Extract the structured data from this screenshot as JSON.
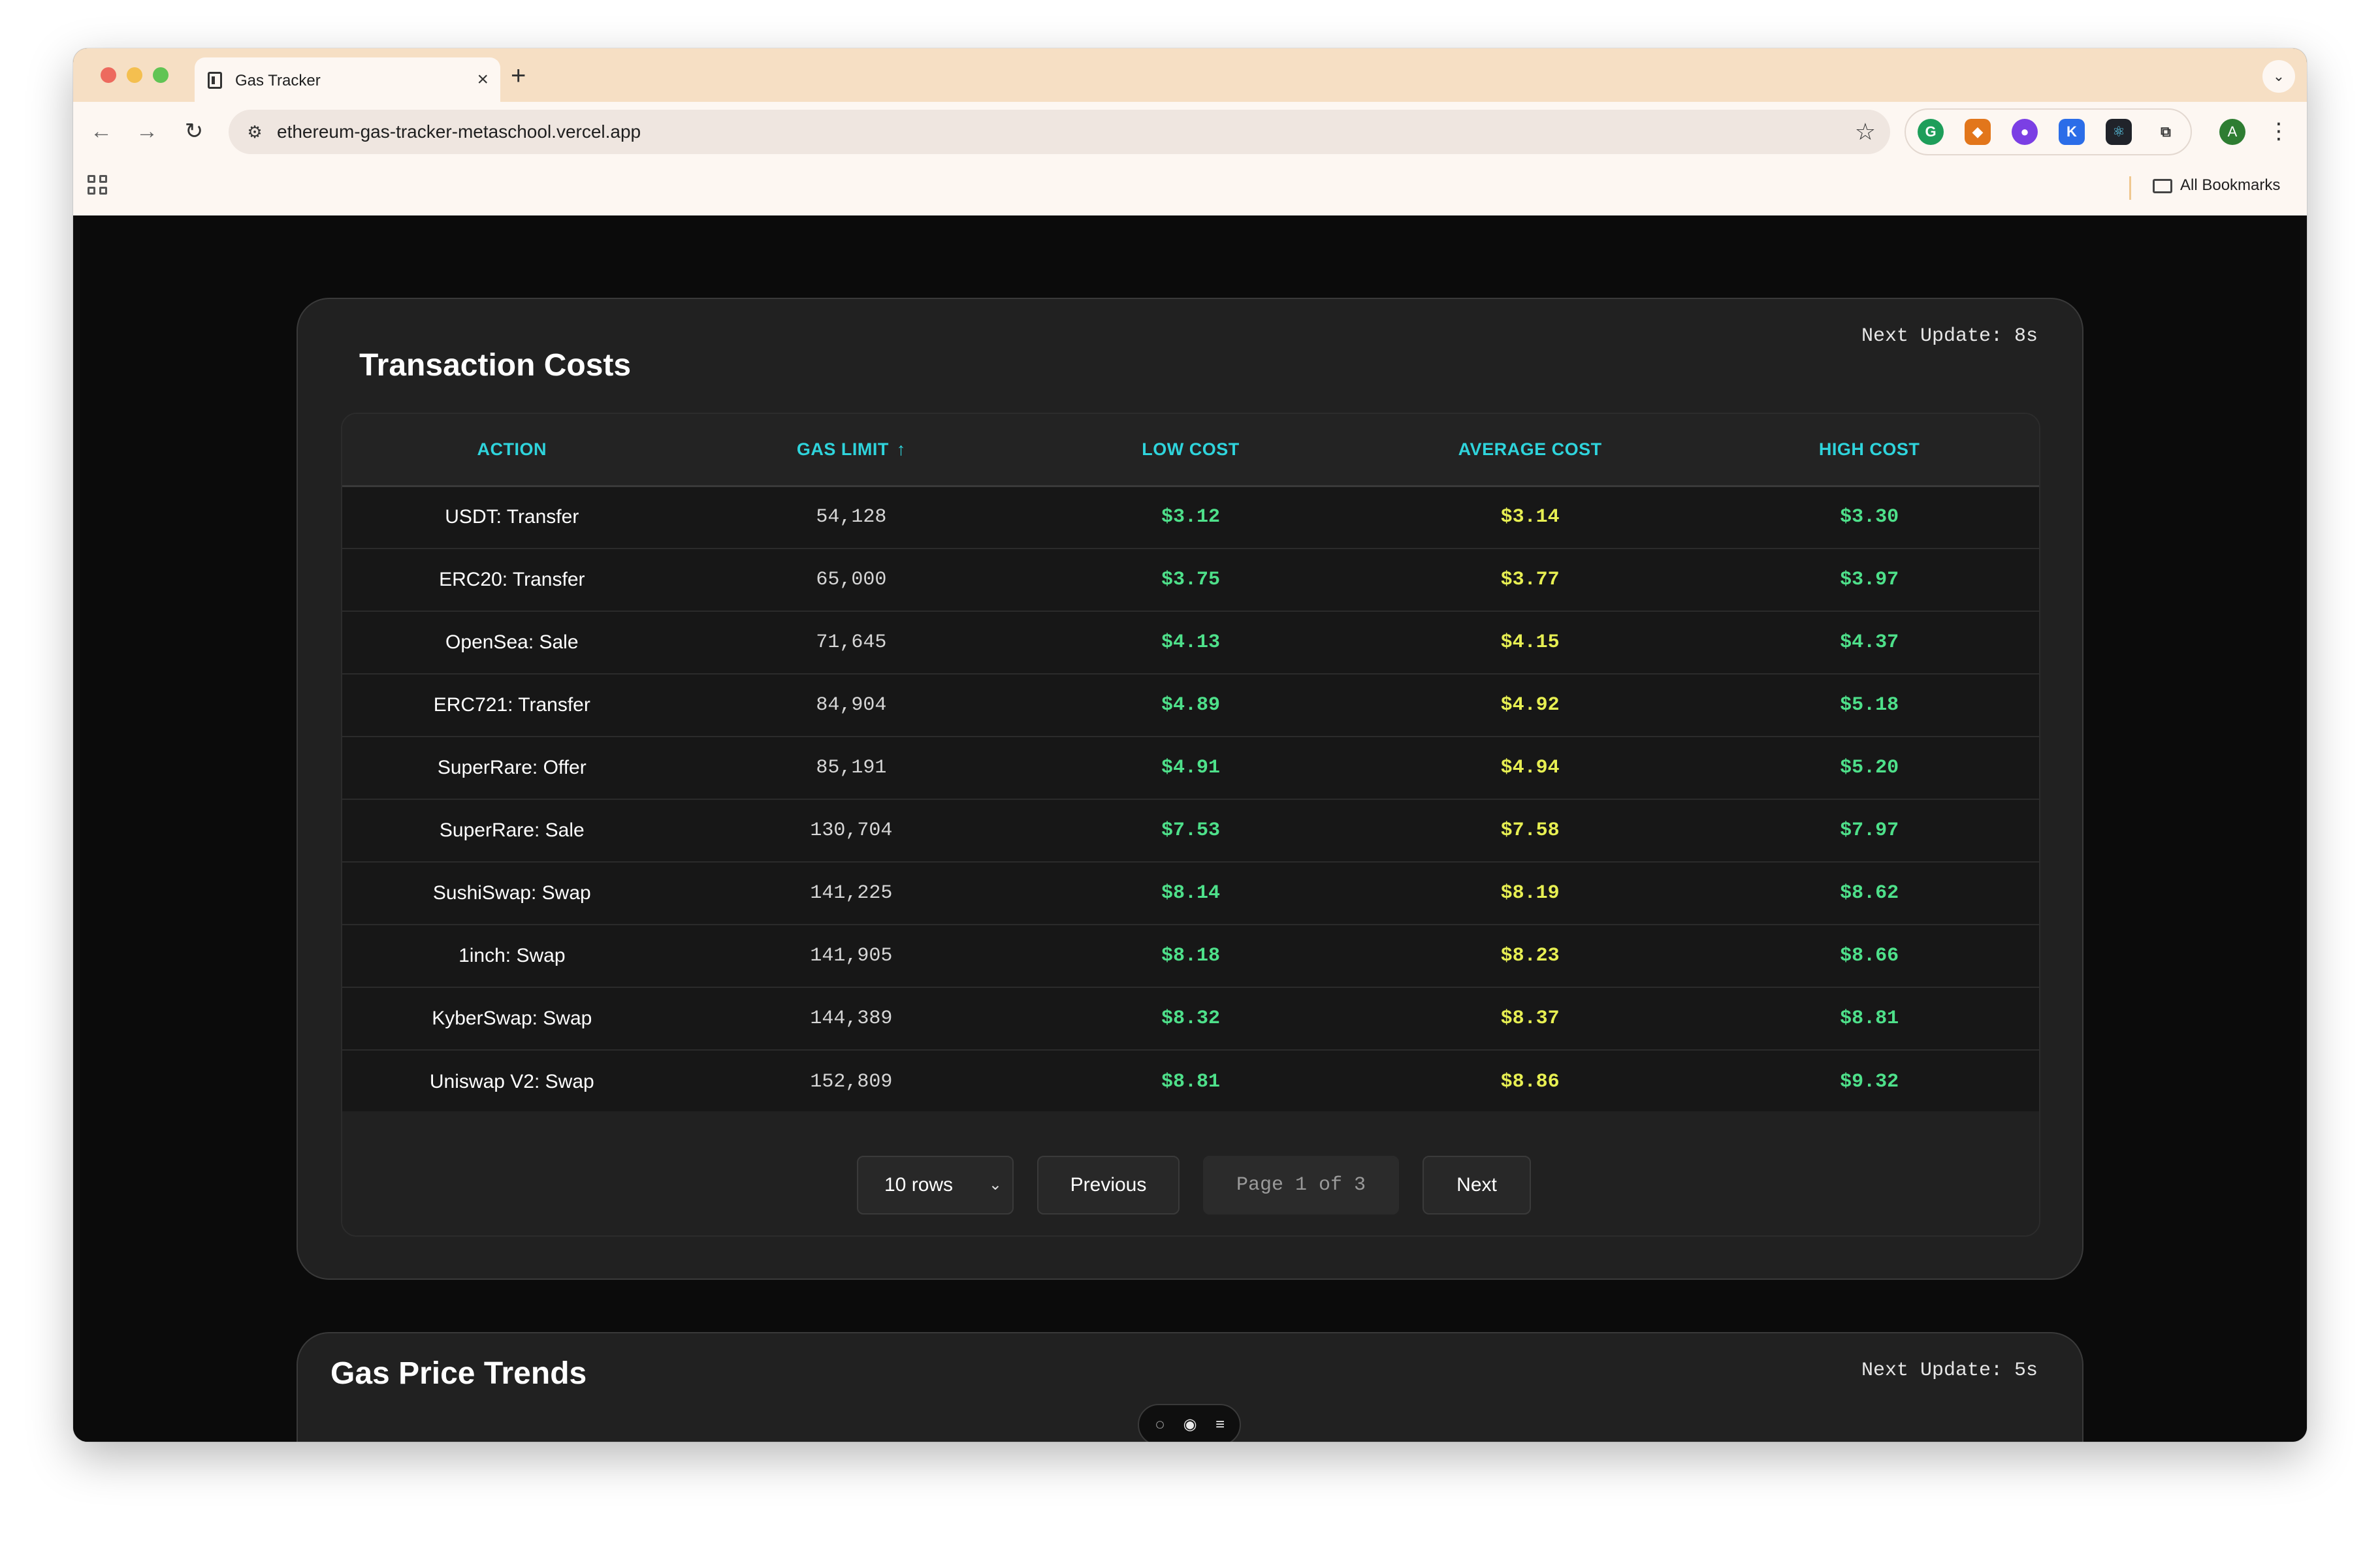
{
  "browser": {
    "tab_title": "Gas Tracker",
    "url": "ethereum-gas-tracker-metaschool.vercel.app",
    "profile_initial": "A",
    "all_bookmarks": "All Bookmarks"
  },
  "transaction_costs": {
    "title": "Transaction Costs",
    "next_update": "Next Update: 8s",
    "columns": [
      "ACTION",
      "GAS LIMIT",
      "LOW COST",
      "AVERAGE COST",
      "HIGH COST"
    ],
    "sort_indicator": "↑",
    "rows": [
      {
        "action": "USDT: Transfer",
        "gas_limit": "54,128",
        "low": "$3.12",
        "avg": "$3.14",
        "high": "$3.30"
      },
      {
        "action": "ERC20: Transfer",
        "gas_limit": "65,000",
        "low": "$3.75",
        "avg": "$3.77",
        "high": "$3.97"
      },
      {
        "action": "OpenSea: Sale",
        "gas_limit": "71,645",
        "low": "$4.13",
        "avg": "$4.15",
        "high": "$4.37"
      },
      {
        "action": "ERC721: Transfer",
        "gas_limit": "84,904",
        "low": "$4.89",
        "avg": "$4.92",
        "high": "$5.18"
      },
      {
        "action": "SuperRare: Offer",
        "gas_limit": "85,191",
        "low": "$4.91",
        "avg": "$4.94",
        "high": "$5.20"
      },
      {
        "action": "SuperRare: Sale",
        "gas_limit": "130,704",
        "low": "$7.53",
        "avg": "$7.58",
        "high": "$7.97"
      },
      {
        "action": "SushiSwap: Swap",
        "gas_limit": "141,225",
        "low": "$8.14",
        "avg": "$8.19",
        "high": "$8.62"
      },
      {
        "action": "1inch: Swap",
        "gas_limit": "141,905",
        "low": "$8.18",
        "avg": "$8.23",
        "high": "$8.66"
      },
      {
        "action": "KyberSwap: Swap",
        "gas_limit": "144,389",
        "low": "$8.32",
        "avg": "$8.37",
        "high": "$8.81"
      },
      {
        "action": "Uniswap V2: Swap",
        "gas_limit": "152,809",
        "low": "$8.81",
        "avg": "$8.86",
        "high": "$9.32"
      }
    ],
    "pagination": {
      "rows_select": "10 rows",
      "previous": "Previous",
      "page_indicator": "Page 1 of 3",
      "next": "Next"
    }
  },
  "gas_price_trends": {
    "title": "Gas Price Trends",
    "next_update": "Next Update: 5s"
  }
}
